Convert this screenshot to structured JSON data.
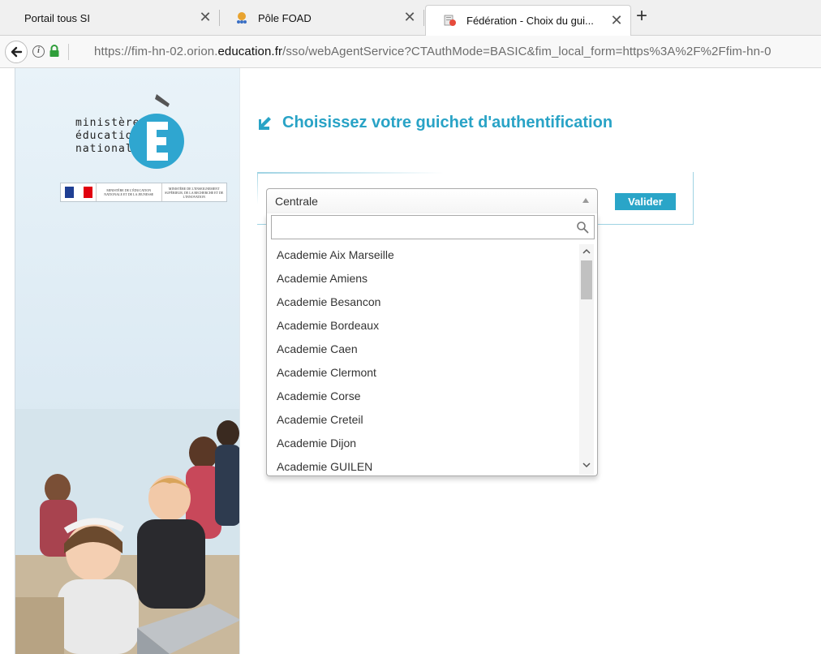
{
  "browser": {
    "tabs": [
      {
        "label": "Portail tous SI"
      },
      {
        "label": "Pôle FOAD"
      },
      {
        "label": "Fédération - Choix du gui..."
      }
    ],
    "close_glyph": "✕",
    "new_tab_glyph": "+",
    "back_glyph": "🡐",
    "info_glyph": "i",
    "url_prefix": "https://fim-hn-02.orion.",
    "url_domain": "education.fr",
    "url_suffix": "/sso/webAgentService?CTAuthMode=BASIC&fim_local_form=https%3A%2F%2Ffim-hn-0"
  },
  "sidebar": {
    "logo_lines": [
      "ministère",
      "éducation",
      "nationale"
    ],
    "gov_ministries": [
      "MINISTÈRE DE L'ÉDUCATION NATIONALE ET DE LA JEUNESSE",
      "MINISTÈRE DE L'ENSEIGNEMENT SUPÉRIEUR, DE LA RECHERCHE ET DE L'INNOVATION"
    ]
  },
  "main": {
    "heading": "Choisissez votre guichet d'authentification",
    "select": {
      "selected": "Centrale",
      "search_value": "",
      "options": [
        "Academie Aix Marseille",
        "Academie Amiens",
        "Academie Besancon",
        "Academie Bordeaux",
        "Academie Caen",
        "Academie Clermont",
        "Academie Corse",
        "Academie Creteil",
        "Academie Dijon",
        "Academie GUILEN"
      ]
    },
    "submit_label": "Valider"
  },
  "colors": {
    "accent": "#29a3c6",
    "button": "#2aa5c8"
  }
}
